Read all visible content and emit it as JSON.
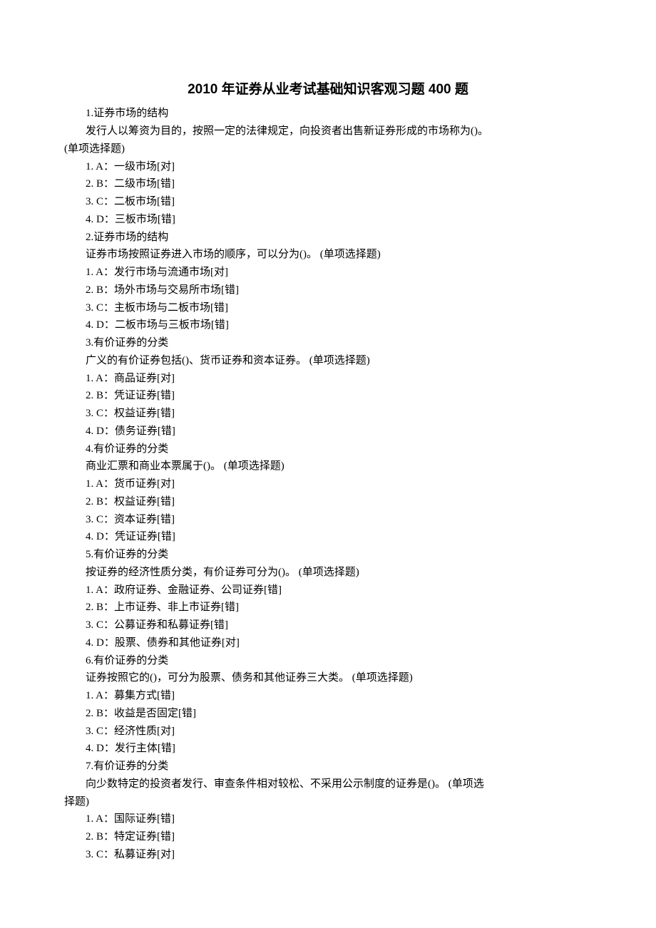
{
  "title": "2010 年证券从业考试基础知识客观习题 400 题",
  "lines": [
    {
      "text": "1.证券市场的结构",
      "indent": true
    },
    {
      "text": "发行人以筹资为目的，按照一定的法律规定，向投资者出售新证券形成的市场称为()。",
      "indent": true
    },
    {
      "text": "(单项选择题)",
      "indent": false
    },
    {
      "text": "1. A：一级市场[对]",
      "indent": true
    },
    {
      "text": "2. B：二级市场[错]",
      "indent": true
    },
    {
      "text": "3. C：二板市场[错]",
      "indent": true
    },
    {
      "text": "4. D：三板市场[错]",
      "indent": true
    },
    {
      "text": "2.证券市场的结构",
      "indent": true
    },
    {
      "text": "证券市场按照证券进入市场的顺序，可以分为()。 (单项选择题)",
      "indent": true
    },
    {
      "text": "1. A：发行市场与流通市场[对]",
      "indent": true
    },
    {
      "text": "2. B：场外市场与交易所市场[错]",
      "indent": true
    },
    {
      "text": "3. C：主板市场与二板市场[错]",
      "indent": true
    },
    {
      "text": "4. D：二板市场与三板市场[错]",
      "indent": true
    },
    {
      "text": "3.有价证券的分类",
      "indent": true
    },
    {
      "text": "广义的有价证券包括()、货币证券和资本证券。 (单项选择题)",
      "indent": true
    },
    {
      "text": "1. A：商品证券[对]",
      "indent": true
    },
    {
      "text": "2. B：凭证证券[错]",
      "indent": true
    },
    {
      "text": "3. C：权益证券[错]",
      "indent": true
    },
    {
      "text": "4. D：债务证券[错]",
      "indent": true
    },
    {
      "text": "4.有价证券的分类",
      "indent": true
    },
    {
      "text": "商业汇票和商业本票属于()。 (单项选择题)",
      "indent": true
    },
    {
      "text": "1. A：货币证券[对]",
      "indent": true
    },
    {
      "text": "2. B：权益证券[错]",
      "indent": true
    },
    {
      "text": "3. C：资本证券[错]",
      "indent": true
    },
    {
      "text": "4. D：凭证证券[错]",
      "indent": true
    },
    {
      "text": "5.有价证券的分类",
      "indent": true
    },
    {
      "text": "按证券的经济性质分类，有价证券可分为()。 (单项选择题)",
      "indent": true
    },
    {
      "text": "1. A：政府证券、金融证券、公司证券[错]",
      "indent": true
    },
    {
      "text": "2. B：上市证券、非上市证券[错]",
      "indent": true
    },
    {
      "text": "3. C：公募证券和私募证券[错]",
      "indent": true
    },
    {
      "text": "4. D：股票、债券和其他证券[对]",
      "indent": true
    },
    {
      "text": "6.有价证券的分类",
      "indent": true
    },
    {
      "text": "证券按照它的()，可分为股票、债务和其他证券三大类。 (单项选择题)",
      "indent": true
    },
    {
      "text": "1. A：募集方式[错]",
      "indent": true
    },
    {
      "text": "2. B：收益是否固定[错]",
      "indent": true
    },
    {
      "text": "3. C：经济性质[对]",
      "indent": true
    },
    {
      "text": "4. D：发行主体[错]",
      "indent": true
    },
    {
      "text": "7.有价证券的分类",
      "indent": true
    },
    {
      "text": "向少数特定的投资者发行、审查条件相对较松、不采用公示制度的证券是()。 (单项选",
      "indent": true
    },
    {
      "text": "择题)",
      "indent": false
    },
    {
      "text": "1. A：国际证券[错]",
      "indent": true
    },
    {
      "text": "2. B：特定证券[错]",
      "indent": true
    },
    {
      "text": "3. C：私募证券[对]",
      "indent": true
    }
  ]
}
